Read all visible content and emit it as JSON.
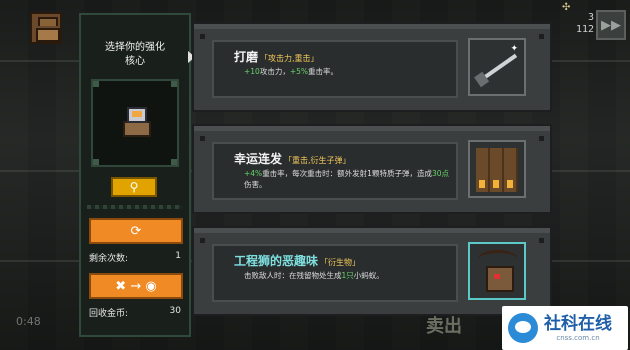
{
  "hud": {
    "top_value": "3",
    "count": "112",
    "ff_icon": "fast-forward-icon"
  },
  "core_panel": {
    "title": "选择你的强化\n核心",
    "search_icon": "magnifier-icon",
    "refresh_icon": "refresh-icon",
    "refresh_count_label": "剩余次数:",
    "refresh_count_value": "1",
    "sell_icon": "sell-core-icon",
    "recycle_label": "回收金币:",
    "recycle_value": "30"
  },
  "cards": [
    {
      "name": "打磨",
      "tag": "「攻击力,重击」",
      "desc": [
        {
          "text": "+10",
          "hl": true
        },
        {
          "text": "攻击力，",
          "hl": false
        },
        {
          "text": "+5%",
          "hl": true
        },
        {
          "text": "重击率。",
          "hl": false
        }
      ],
      "icon": "sword-icon"
    },
    {
      "name": "幸运连发",
      "tag": "「重击,衍生子弹」",
      "desc": [
        {
          "text": "+4%",
          "hl": true
        },
        {
          "text": "重击率，每次重击时：额外发射1颗特质子弹，造成",
          "hl": false
        },
        {
          "text": "30点",
          "hl": true
        },
        {
          "text": "伤害。",
          "hl": false
        }
      ],
      "icon": "bullets-icon"
    },
    {
      "name": "工程狮的恶趣味",
      "tag": "「衍生物」",
      "desc": [
        {
          "text": "击败敌人时：在残留物处生成",
          "hl": false
        },
        {
          "text": "1只",
          "hl": true
        },
        {
          "text": "小蚂蚁。",
          "hl": false
        }
      ],
      "icon": "ant-monster-icon"
    }
  ],
  "background": {
    "timer": "0:48",
    "sell_text": "卖出"
  },
  "watermark": {
    "title": "社科在线",
    "url": "cnss.com.cn"
  }
}
